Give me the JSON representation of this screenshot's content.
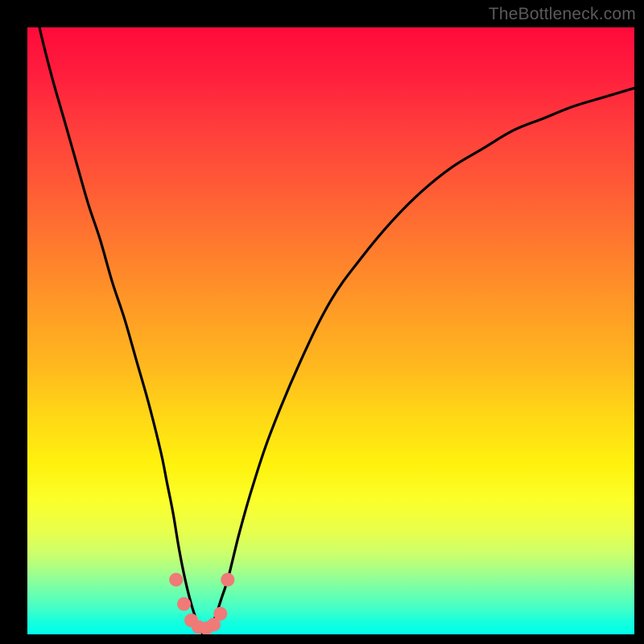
{
  "watermark": "TheBottleneck.com",
  "chart_data": {
    "type": "line",
    "title": "",
    "xlabel": "",
    "ylabel": "",
    "xlim": [
      0,
      100
    ],
    "ylim": [
      0,
      100
    ],
    "colors": {
      "curve": "#000000",
      "markers": "#ef7a78",
      "gradient_top": "#ff0a3a",
      "gradient_bottom": "#00ffea"
    },
    "curve_minimum_x": 29,
    "series": [
      {
        "name": "bottleneck-curve",
        "x": [
          0,
          2,
          4,
          6,
          8,
          10,
          12,
          14,
          16,
          18,
          20,
          22,
          23,
          24,
          25,
          26,
          27,
          28,
          29,
          30,
          31,
          32,
          33,
          34,
          35,
          37,
          40,
          45,
          50,
          55,
          60,
          65,
          70,
          75,
          80,
          85,
          90,
          95,
          100
        ],
        "values": [
          110,
          100,
          92,
          85,
          78,
          71,
          65,
          58,
          52,
          45,
          38,
          30,
          25,
          20,
          14,
          9,
          5,
          2,
          0,
          1,
          3,
          6,
          9,
          13,
          17,
          24,
          33,
          45,
          55,
          62,
          68,
          73,
          77,
          80,
          83,
          85,
          87,
          88.5,
          90
        ]
      }
    ],
    "markers": [
      {
        "x": 24.5,
        "y": 9
      },
      {
        "x": 25.8,
        "y": 5
      },
      {
        "x": 27.0,
        "y": 2.3
      },
      {
        "x": 28.2,
        "y": 1.2
      },
      {
        "x": 29.5,
        "y": 1.0
      },
      {
        "x": 30.7,
        "y": 1.6
      },
      {
        "x": 31.8,
        "y": 3.4
      },
      {
        "x": 33.0,
        "y": 9.0
      }
    ]
  }
}
